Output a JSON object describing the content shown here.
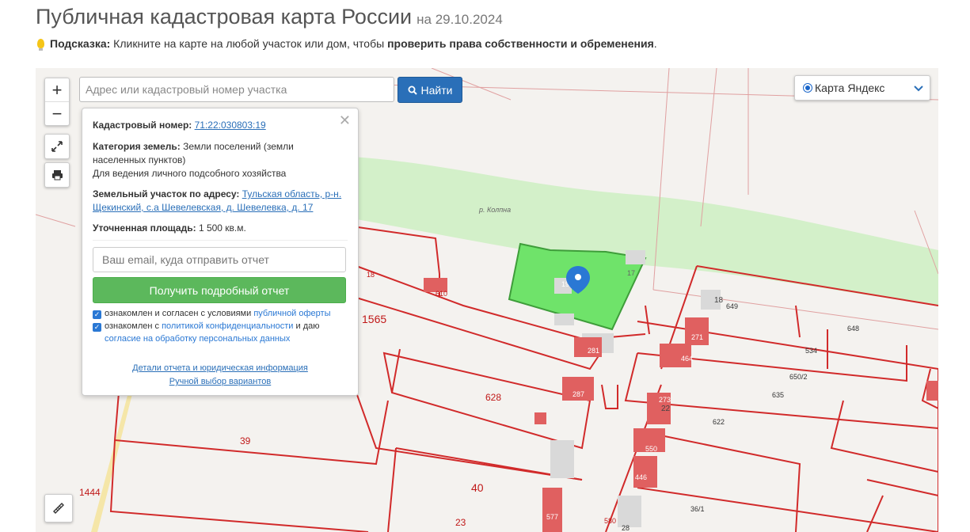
{
  "header": {
    "title": "Публичная кадастровая карта России",
    "date": "на 29.10.2024"
  },
  "hint": {
    "label": "Подсказка:",
    "text": " Кликните на карте на любой участок или дом, чтобы ",
    "bold_text": "проверить права собственности и обременения",
    "end": "."
  },
  "map_controls": {
    "zoom_in": "+",
    "zoom_out": "−",
    "search_placeholder": "Адрес или кадастровый номер участка",
    "find_label": "Найти",
    "layer_selected": "Карта Яндекс"
  },
  "popup": {
    "cadastral_label": "Кадастровый номер:",
    "cadastral_number": "71:22:030803:19",
    "category_label": "Категория земель:",
    "category_value": "Земли поселений (земли населенных пунктов)",
    "usage": "Для ведения личного подсобного хозяйства",
    "address_label": "Земельный участок по адресу:",
    "address_value": "Тульская область, р-н. Щекинский, с.а Шевелевская, д. Шевелевка, д. 17",
    "area_label": "Уточненная площадь:",
    "area_value": "1 500 кв.м.",
    "email_placeholder": "Ваш email, куда отправить отчет",
    "report_button": "Получить подробный отчет",
    "consent1_text": "ознакомлен и согласен с условиями ",
    "consent1_link": "публичной оферты",
    "consent2_text": "ознакомлен с ",
    "consent2_link": "политикой конфиденциальности",
    "consent2_mid": " и даю ",
    "consent2_link2": "согласие на обработку персональных данных",
    "link_details": "Детали отчета и юридическая информация",
    "link_manual": "Ручной выбор вариантов"
  },
  "map_labels": {
    "river": "р. Колпна",
    "parcels": [
      "18",
      "610",
      "1565",
      "19",
      "17",
      "18",
      "649",
      "648",
      "271",
      "281",
      "534",
      "464",
      "650/2",
      "287",
      "628",
      "635",
      "273",
      "22",
      "622",
      "39",
      "550",
      "40",
      "446",
      "1444",
      "577",
      "580",
      "23",
      "36/1",
      "28"
    ]
  },
  "colors": {
    "parcel_border": "#d12a2a",
    "selected_parcel": "#6fe36a",
    "river_band": "#d3f0c9",
    "building": "#d9d9d9",
    "building_red": "#e06060",
    "button_blue": "#2a6fb8",
    "button_green": "#5cb85c"
  }
}
